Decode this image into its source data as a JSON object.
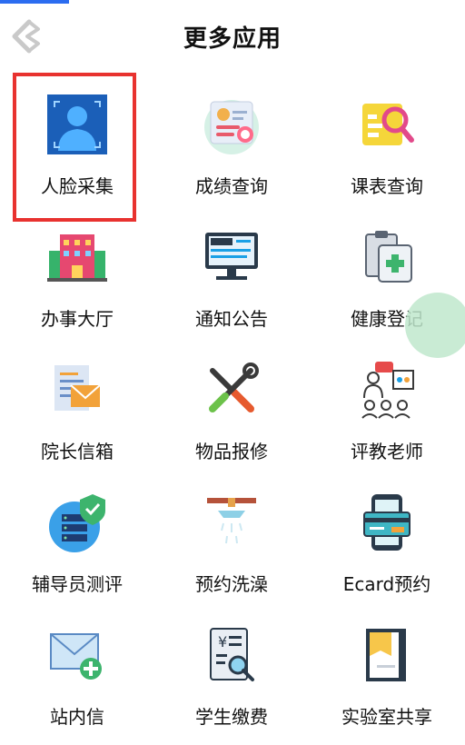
{
  "header": {
    "title": "更多应用"
  },
  "colors": {
    "highlight": "#e8322f",
    "accent": "#2b6cf0",
    "bubble": "#bfe8cc"
  },
  "apps": [
    {
      "label": "人脸采集",
      "icon": "face-scan-icon"
    },
    {
      "label": "成绩查询",
      "icon": "grade-report-icon"
    },
    {
      "label": "课表查询",
      "icon": "schedule-search-icon"
    },
    {
      "label": "办事大厅",
      "icon": "office-building-icon"
    },
    {
      "label": "通知公告",
      "icon": "news-monitor-icon"
    },
    {
      "label": "健康登记",
      "icon": "health-clipboard-icon"
    },
    {
      "label": "院长信箱",
      "icon": "mailbox-icon"
    },
    {
      "label": "物品报修",
      "icon": "repair-tools-icon"
    },
    {
      "label": "评教老师",
      "icon": "teacher-evaluation-icon"
    },
    {
      "label": "辅导员测评",
      "icon": "server-shield-icon"
    },
    {
      "label": "预约洗澡",
      "icon": "shower-icon"
    },
    {
      "label": "Ecard预约",
      "icon": "ecard-phone-icon"
    },
    {
      "label": "站内信",
      "icon": "mail-add-icon"
    },
    {
      "label": "学生缴费",
      "icon": "fee-invoice-icon"
    },
    {
      "label": "实验室共享",
      "icon": "lab-notebook-icon"
    }
  ]
}
